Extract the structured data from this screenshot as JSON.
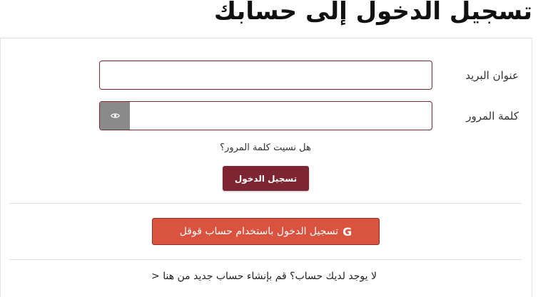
{
  "page": {
    "title": "تسجيل الدخول إلى حسابك"
  },
  "form": {
    "email_label": "عنوان البريد",
    "email_value": "",
    "password_label": "كلمة المرور",
    "password_value": "",
    "forgot_text": "هل نسيت كلمة المرور؟",
    "login_label": "تسجيل الدخول"
  },
  "social": {
    "google_icon": "G",
    "google_label": "تسجيل الدخول باستخدام حساب قوقل"
  },
  "footer": {
    "register_text": "لا يوجد لديك حساب؟ قم بإنشاء حساب جديد من هنا",
    "register_arrow": "<"
  },
  "colors": {
    "primary": "#7e2533",
    "google": "#d9533f",
    "input_border": "#7a2a36",
    "eye_toggle": "#8a8a8a"
  },
  "icons": {
    "eye": "eye-icon"
  }
}
